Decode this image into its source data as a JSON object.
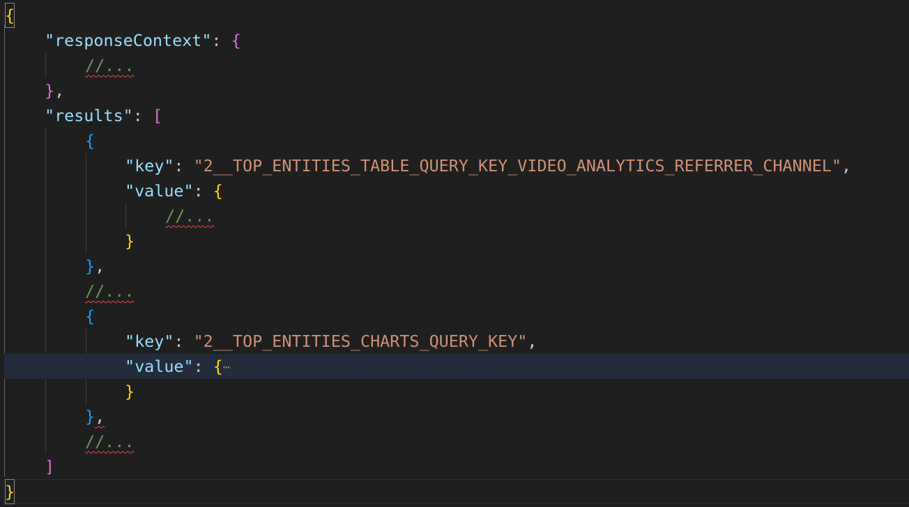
{
  "editor": {
    "lines": {
      "l1": {
        "open": "{"
      },
      "l2": {
        "key": "\"responseContext\"",
        "colon": ": ",
        "open": "{"
      },
      "l3": {
        "comment": "//..."
      },
      "l4": {
        "close": "}",
        "comma": ","
      },
      "l5": {
        "key": "\"results\"",
        "colon": ": ",
        "open": "["
      },
      "l6": {
        "open": "{"
      },
      "l7": {
        "key": "\"key\"",
        "colon": ": ",
        "value": "\"2__TOP_ENTITIES_TABLE_QUERY_KEY_VIDEO_ANALYTICS_REFERRER_CHANNEL\"",
        "comma": ","
      },
      "l8": {
        "key": "\"value\"",
        "colon": ": ",
        "open": "{"
      },
      "l9": {
        "comment": "//..."
      },
      "l10": {
        "close": "}"
      },
      "l11": {
        "close": "}",
        "comma": ","
      },
      "l12": {
        "comment": "//..."
      },
      "l13": {
        "open": "{"
      },
      "l14": {
        "key": "\"key\"",
        "colon": ": ",
        "value": "\"2__TOP_ENTITIES_CHARTS_QUERY_KEY\"",
        "comma": ","
      },
      "l15": {
        "key": "\"value\"",
        "colon": ": ",
        "open": "{",
        "folded": "⋯"
      },
      "l16": {
        "close": "}"
      },
      "l17": {
        "close": "}",
        "comma": ","
      },
      "l18": {
        "comment": "//..."
      },
      "l19": {
        "close": "]"
      },
      "l20": {
        "close": "}"
      }
    },
    "colors": {
      "background": "#1f1f1f",
      "key": "#9cdcfe",
      "string": "#ce9178",
      "comment": "#6a9955",
      "bracket_level1": "#ffd700",
      "bracket_level2": "#da70d6",
      "bracket_level3": "#179fff",
      "error_squiggle": "#f14c4c",
      "current_line": "#222c3b"
    }
  }
}
